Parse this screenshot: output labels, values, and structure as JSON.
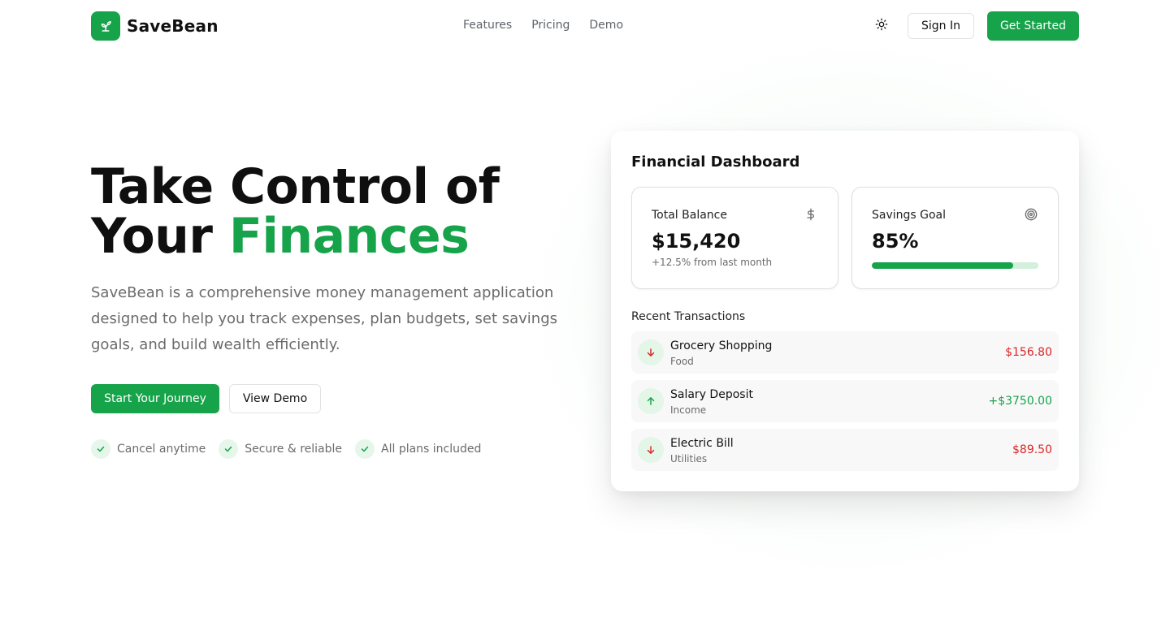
{
  "brand": {
    "name": "SaveBean",
    "accent": "#16a34a",
    "icon": "sprout-icon"
  },
  "nav": {
    "items": [
      "Features",
      "Pricing",
      "Demo"
    ]
  },
  "header": {
    "theme_icon": "sun-icon",
    "sign_in": "Sign In",
    "get_started": "Get Started"
  },
  "hero": {
    "title_line1": "Take Control of",
    "title_line2_plain": "Your ",
    "title_line2_accent": "Finances",
    "description": "SaveBean is a comprehensive money management application designed to help you track expenses, plan budgets, set savings goals, and build wealth efficiently.",
    "primary_cta": "Start Your Journey",
    "secondary_cta": "View Demo",
    "features": [
      "Cancel anytime",
      "Secure & reliable",
      "All plans included"
    ]
  },
  "dashboard": {
    "title": "Financial Dashboard",
    "total_balance": {
      "label": "Total Balance",
      "value": "$15,420",
      "change": "+12.5% from last month",
      "icon": "dollar-icon"
    },
    "savings_goal": {
      "label": "Savings Goal",
      "value": "85%",
      "progress": 0.85,
      "icon": "target-icon"
    },
    "recent_label": "Recent Transactions",
    "transactions": [
      {
        "name": "Grocery Shopping",
        "category": "Food",
        "amount": "$156.80",
        "direction": "down"
      },
      {
        "name": "Salary Deposit",
        "category": "Income",
        "amount": "+$3750.00",
        "direction": "up"
      },
      {
        "name": "Electric Bill",
        "category": "Utilities",
        "amount": "$89.50",
        "direction": "down"
      }
    ],
    "colors": {
      "expense": "#dc2626",
      "income": "#16a34a"
    }
  }
}
